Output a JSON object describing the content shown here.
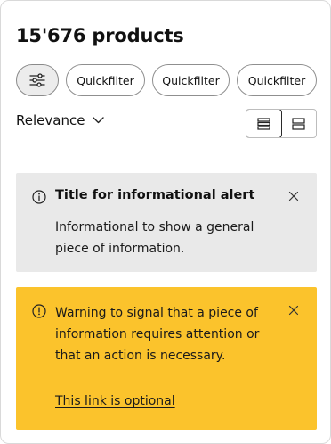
{
  "header": {
    "title": "15'676 products"
  },
  "filters": {
    "filter_icon": "sliders-icon",
    "chips": [
      {
        "label": "Quickfilter"
      },
      {
        "label": "Quickfilter"
      },
      {
        "label": "Quickfilter"
      }
    ]
  },
  "sort": {
    "label": "Relevance",
    "icon": "chevron-down-icon"
  },
  "view_toggle": {
    "options": [
      "list-view-icon",
      "grid-view-icon"
    ],
    "selected": "list-view-icon"
  },
  "alerts": {
    "info": {
      "icon": "info-icon",
      "title": "Title for informational alert",
      "body": "Informational to show a general piece of information.",
      "background": "#e9e9e9"
    },
    "warning": {
      "icon": "warning-icon",
      "body": "Warning to signal that a piece of information requires attention or that an action is necessary.",
      "link": "This link is optional",
      "background": "#fbc32c"
    }
  }
}
